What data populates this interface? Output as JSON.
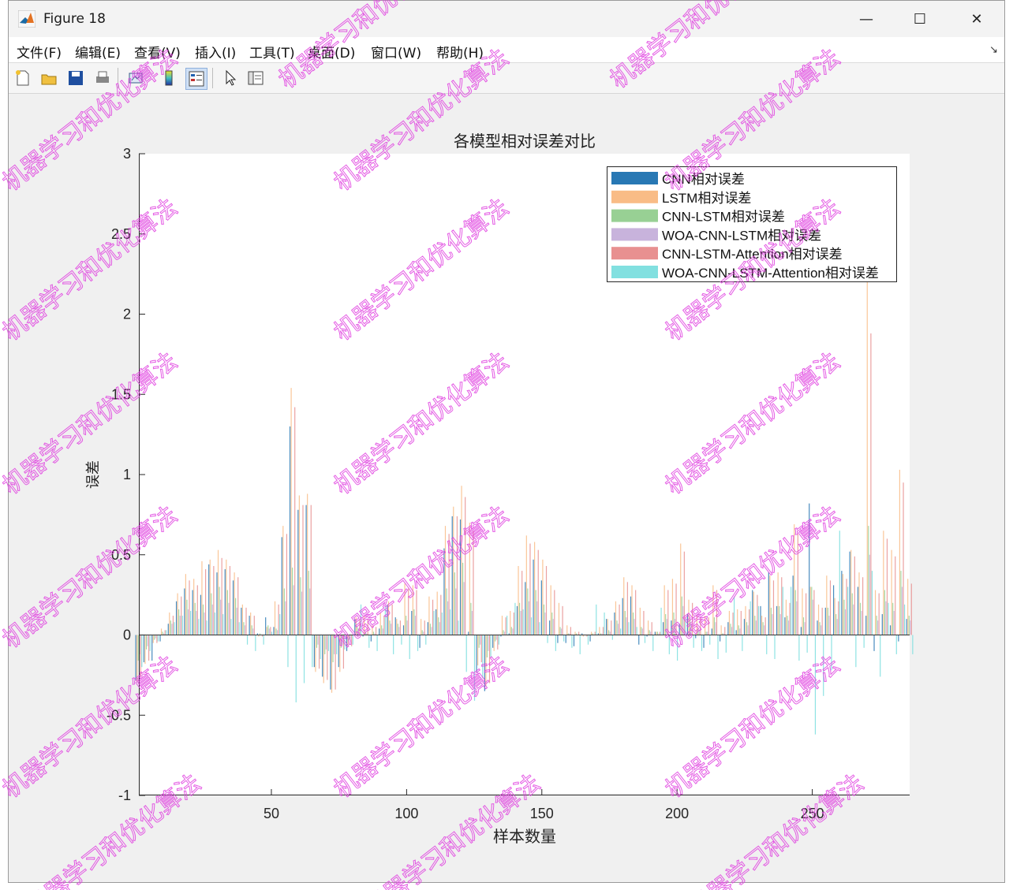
{
  "window": {
    "title": "Figure 18",
    "controls": {
      "minimize": "—",
      "maximize": "☐",
      "close": "✕"
    }
  },
  "menu": [
    {
      "label": "文件(F)"
    },
    {
      "label": "编辑(E)"
    },
    {
      "label": "查看(V)"
    },
    {
      "label": "插入(I)"
    },
    {
      "label": "工具(T)"
    },
    {
      "label": "桌面(D)"
    },
    {
      "label": "窗口(W)"
    },
    {
      "label": "帮助(H)"
    }
  ],
  "toolbar": {
    "icons": [
      "new-figure-icon",
      "open-file-icon",
      "save-icon",
      "print-icon",
      "link-plot-icon",
      "colorbar-icon",
      "legend-icon",
      "pointer-icon",
      "property-inspector-icon"
    ]
  },
  "watermark": {
    "text": "机器学习和优化算法",
    "color": "#e040e0"
  },
  "chart_data": {
    "type": "bar",
    "title": "各模型相对误差对比",
    "xlabel": "样本数量",
    "ylabel": "误差",
    "xlim": [
      1,
      286
    ],
    "ylim": [
      -1,
      3
    ],
    "xticks": [
      50,
      100,
      150,
      200,
      250
    ],
    "yticks": [
      -1,
      -0.5,
      0,
      0.5,
      1,
      1.5,
      2,
      2.5,
      3
    ],
    "ytick_labels": [
      "-1",
      "-0.5",
      "0",
      "0.5",
      "1",
      "1.5",
      "2",
      "2.5",
      "3"
    ],
    "xtick_labels": [
      "50",
      "100",
      "150",
      "200",
      "250"
    ],
    "grid": false,
    "legend_position": "top-right",
    "x_step": 3,
    "series": [
      {
        "name": "CNN相对误差",
        "color": "#2878b4",
        "values": [
          -0.28,
          -0.17,
          -0.16,
          -0.04,
          0.07,
          0.21,
          0.29,
          0.28,
          0.25,
          0.44,
          0.39,
          0.41,
          0.34,
          0.17,
          0.12,
          0.01,
          0.11,
          0.05,
          0.61,
          1.3,
          0.78,
          0.81,
          -0.2,
          -0.26,
          -0.34,
          -0.2,
          -0.1,
          0.1,
          -0.01,
          -0.04,
          0.04,
          0.19,
          0.11,
          0.06,
          0.15,
          -0.08,
          0.08,
          0.16,
          0.54,
          0.74,
          0.72,
          0.02,
          -0.23,
          -0.35,
          -0.08,
          -0.01,
          0.01,
          0.18,
          0.33,
          0.47,
          0.34,
          0.09,
          -0.05,
          -0.05,
          -0.07,
          0.01,
          -0.04,
          0.01,
          0.1,
          0.14,
          0.23,
          0.24,
          -0.06,
          -0.01,
          0.02,
          0.08,
          0.09,
          0.07,
          0.13,
          -0.02,
          -0.08,
          0.04,
          -0.04,
          0.08,
          0.03,
          0.1,
          0.28,
          0.18,
          0.39,
          0.18,
          0.11,
          0.37,
          0.05,
          0.82,
          0.09,
          0.17,
          0.31,
          0.4,
          0.52,
          0.3,
          0.12,
          -0.1,
          0.13,
          0.06,
          -0.04,
          0.1
        ]
      },
      {
        "name": "LSTM相对误差",
        "color": "#f9bc86",
        "values": [
          -0.29,
          -0.18,
          -0.05,
          0.04,
          0.14,
          0.26,
          0.38,
          0.35,
          0.46,
          0.47,
          0.53,
          0.47,
          0.39,
          0.19,
          0.14,
          -0.01,
          0.05,
          0.21,
          0.68,
          1.54,
          0.87,
          0.88,
          -0.23,
          -0.3,
          -0.36,
          -0.23,
          -0.07,
          0.11,
          0.12,
          0.06,
          0.14,
          0.21,
          0.1,
          0.32,
          0.31,
          0.1,
          0.24,
          0.27,
          0.68,
          0.8,
          0.93,
          0.7,
          -0.19,
          -0.32,
          -0.1,
          0.12,
          0.15,
          0.43,
          0.62,
          0.58,
          0.47,
          0.31,
          0.2,
          0.06,
          0.02,
          -0.01,
          0.02,
          0.05,
          0.1,
          0.21,
          0.36,
          0.31,
          0.17,
          0.09,
          0.02,
          0.31,
          0.35,
          0.57,
          0.22,
          0.12,
          0.12,
          0.31,
          0.06,
          0.15,
          0.16,
          0.18,
          0.27,
          0.12,
          0.37,
          0.39,
          0.22,
          0.69,
          0.29,
          0.3,
          0.19,
          0.37,
          0.23,
          0.38,
          0.53,
          0.39,
          2.2,
          0.28,
          0.65,
          0.53,
          1.03,
          0.35
        ]
      },
      {
        "name": "CNN-LSTM相对误差",
        "color": "#98d094",
        "values": [
          -0.16,
          -0.09,
          -0.03,
          0.02,
          0.09,
          0.16,
          0.22,
          0.2,
          0.19,
          0.26,
          0.3,
          0.28,
          0.23,
          0.08,
          0.06,
          0.01,
          0.06,
          0.04,
          0.29,
          0.42,
          0.36,
          0.4,
          -0.08,
          -0.12,
          -0.17,
          -0.08,
          -0.03,
          0.05,
          0.02,
          0.02,
          0.06,
          0.09,
          0.07,
          0.12,
          0.16,
          0.03,
          0.07,
          0.11,
          0.29,
          0.39,
          0.45,
          0.2,
          -0.08,
          -0.14,
          -0.04,
          0.03,
          0.05,
          0.2,
          0.29,
          0.28,
          0.19,
          0.14,
          0.05,
          0.01,
          0.01,
          0.0,
          0.01,
          0.01,
          0.03,
          0.09,
          0.15,
          0.14,
          0.05,
          0.03,
          0.02,
          0.13,
          0.14,
          0.24,
          0.1,
          0.04,
          0.02,
          0.11,
          0.01,
          0.07,
          0.06,
          0.08,
          0.12,
          0.08,
          0.17,
          0.18,
          0.12,
          0.28,
          0.11,
          0.3,
          0.08,
          0.17,
          0.13,
          0.22,
          0.26,
          0.2,
          0.68,
          0.12,
          0.28,
          0.2,
          0.4,
          0.12
        ]
      },
      {
        "name": "WOA-CNN-LSTM相对误差",
        "color": "#c8b3dc",
        "values": [
          -0.12,
          -0.07,
          -0.02,
          0.01,
          0.07,
          0.12,
          0.16,
          0.15,
          0.14,
          0.19,
          0.22,
          0.2,
          0.17,
          0.06,
          0.04,
          0.0,
          0.04,
          0.03,
          0.21,
          0.31,
          0.27,
          0.29,
          -0.06,
          -0.09,
          -0.12,
          -0.06,
          -0.02,
          0.04,
          0.01,
          0.01,
          0.04,
          0.07,
          0.05,
          0.09,
          0.12,
          0.02,
          0.05,
          0.08,
          0.21,
          0.29,
          0.33,
          0.15,
          -0.06,
          -0.1,
          -0.03,
          0.02,
          0.04,
          0.15,
          0.21,
          0.21,
          0.14,
          0.1,
          0.04,
          0.01,
          0.0,
          0.0,
          0.0,
          0.01,
          0.02,
          0.07,
          0.11,
          0.1,
          0.04,
          0.02,
          0.01,
          0.1,
          0.1,
          0.18,
          0.07,
          0.03,
          0.02,
          0.08,
          0.01,
          0.05,
          0.04,
          0.06,
          0.09,
          0.06,
          0.13,
          0.13,
          0.09,
          0.21,
          0.08,
          0.22,
          0.06,
          0.12,
          0.1,
          0.16,
          0.19,
          0.15,
          0.5,
          0.09,
          0.21,
          0.15,
          0.3,
          0.09
        ]
      },
      {
        "name": "CNN-LSTM-Attention相对误差",
        "color": "#e89090",
        "values": [
          -0.26,
          -0.16,
          -0.05,
          0.03,
          0.12,
          0.24,
          0.34,
          0.31,
          0.41,
          0.43,
          0.48,
          0.43,
          0.36,
          0.17,
          0.12,
          -0.01,
          0.05,
          0.19,
          0.63,
          1.42,
          0.81,
          0.81,
          -0.21,
          -0.28,
          -0.34,
          -0.21,
          -0.07,
          0.1,
          0.1,
          0.05,
          0.12,
          0.19,
          0.09,
          0.29,
          0.28,
          0.09,
          0.22,
          0.25,
          0.63,
          0.74,
          0.86,
          0.65,
          -0.17,
          -0.3,
          -0.09,
          0.11,
          0.14,
          0.4,
          0.57,
          0.53,
          0.43,
          0.28,
          0.18,
          0.05,
          0.02,
          -0.01,
          0.02,
          0.05,
          0.09,
          0.19,
          0.33,
          0.28,
          0.15,
          0.08,
          0.02,
          0.28,
          0.32,
          0.52,
          0.2,
          0.11,
          0.11,
          0.28,
          0.05,
          0.14,
          0.15,
          0.16,
          0.25,
          0.11,
          0.34,
          0.36,
          0.2,
          0.63,
          0.26,
          0.28,
          0.17,
          0.34,
          0.21,
          0.35,
          0.49,
          0.36,
          1.88,
          0.26,
          0.6,
          0.49,
          0.95,
          0.32
        ]
      },
      {
        "name": "WOA-CNN-LSTM-Attention相对误差",
        "color": "#82e0e0",
        "values": [
          -0.2,
          -0.1,
          -0.04,
          0.03,
          0.08,
          0.12,
          0.15,
          0.1,
          0.09,
          0.14,
          0.13,
          0.1,
          0.08,
          -0.06,
          -0.1,
          -0.06,
          0.02,
          0.13,
          -0.2,
          -0.42,
          -0.3,
          -0.2,
          -0.15,
          -0.1,
          -0.12,
          -0.09,
          -0.06,
          0.19,
          -0.08,
          -0.1,
          0.18,
          -0.12,
          -0.06,
          -0.15,
          -0.1,
          -0.06,
          0.15,
          0.14,
          0.16,
          0.09,
          -0.23,
          -0.41,
          -0.27,
          -0.14,
          -0.06,
          0.12,
          0.2,
          0.16,
          0.11,
          0.08,
          -0.05,
          -0.1,
          -0.04,
          -0.08,
          -0.12,
          -0.06,
          0.19,
          0.14,
          -0.03,
          0.04,
          0.08,
          0.05,
          -0.05,
          -0.1,
          0.17,
          -0.12,
          -0.16,
          0.1,
          -0.08,
          -0.1,
          -0.06,
          -0.15,
          -0.11,
          0.24,
          -0.1,
          0.21,
          0.18,
          -0.12,
          -0.15,
          0.3,
          0.3,
          -0.16,
          -0.11,
          -0.62,
          -0.38,
          -0.22,
          0.65,
          0.3,
          -0.2,
          -0.08,
          0.4,
          -0.26,
          0.2,
          -0.12,
          0.19,
          -0.12
        ]
      }
    ]
  }
}
